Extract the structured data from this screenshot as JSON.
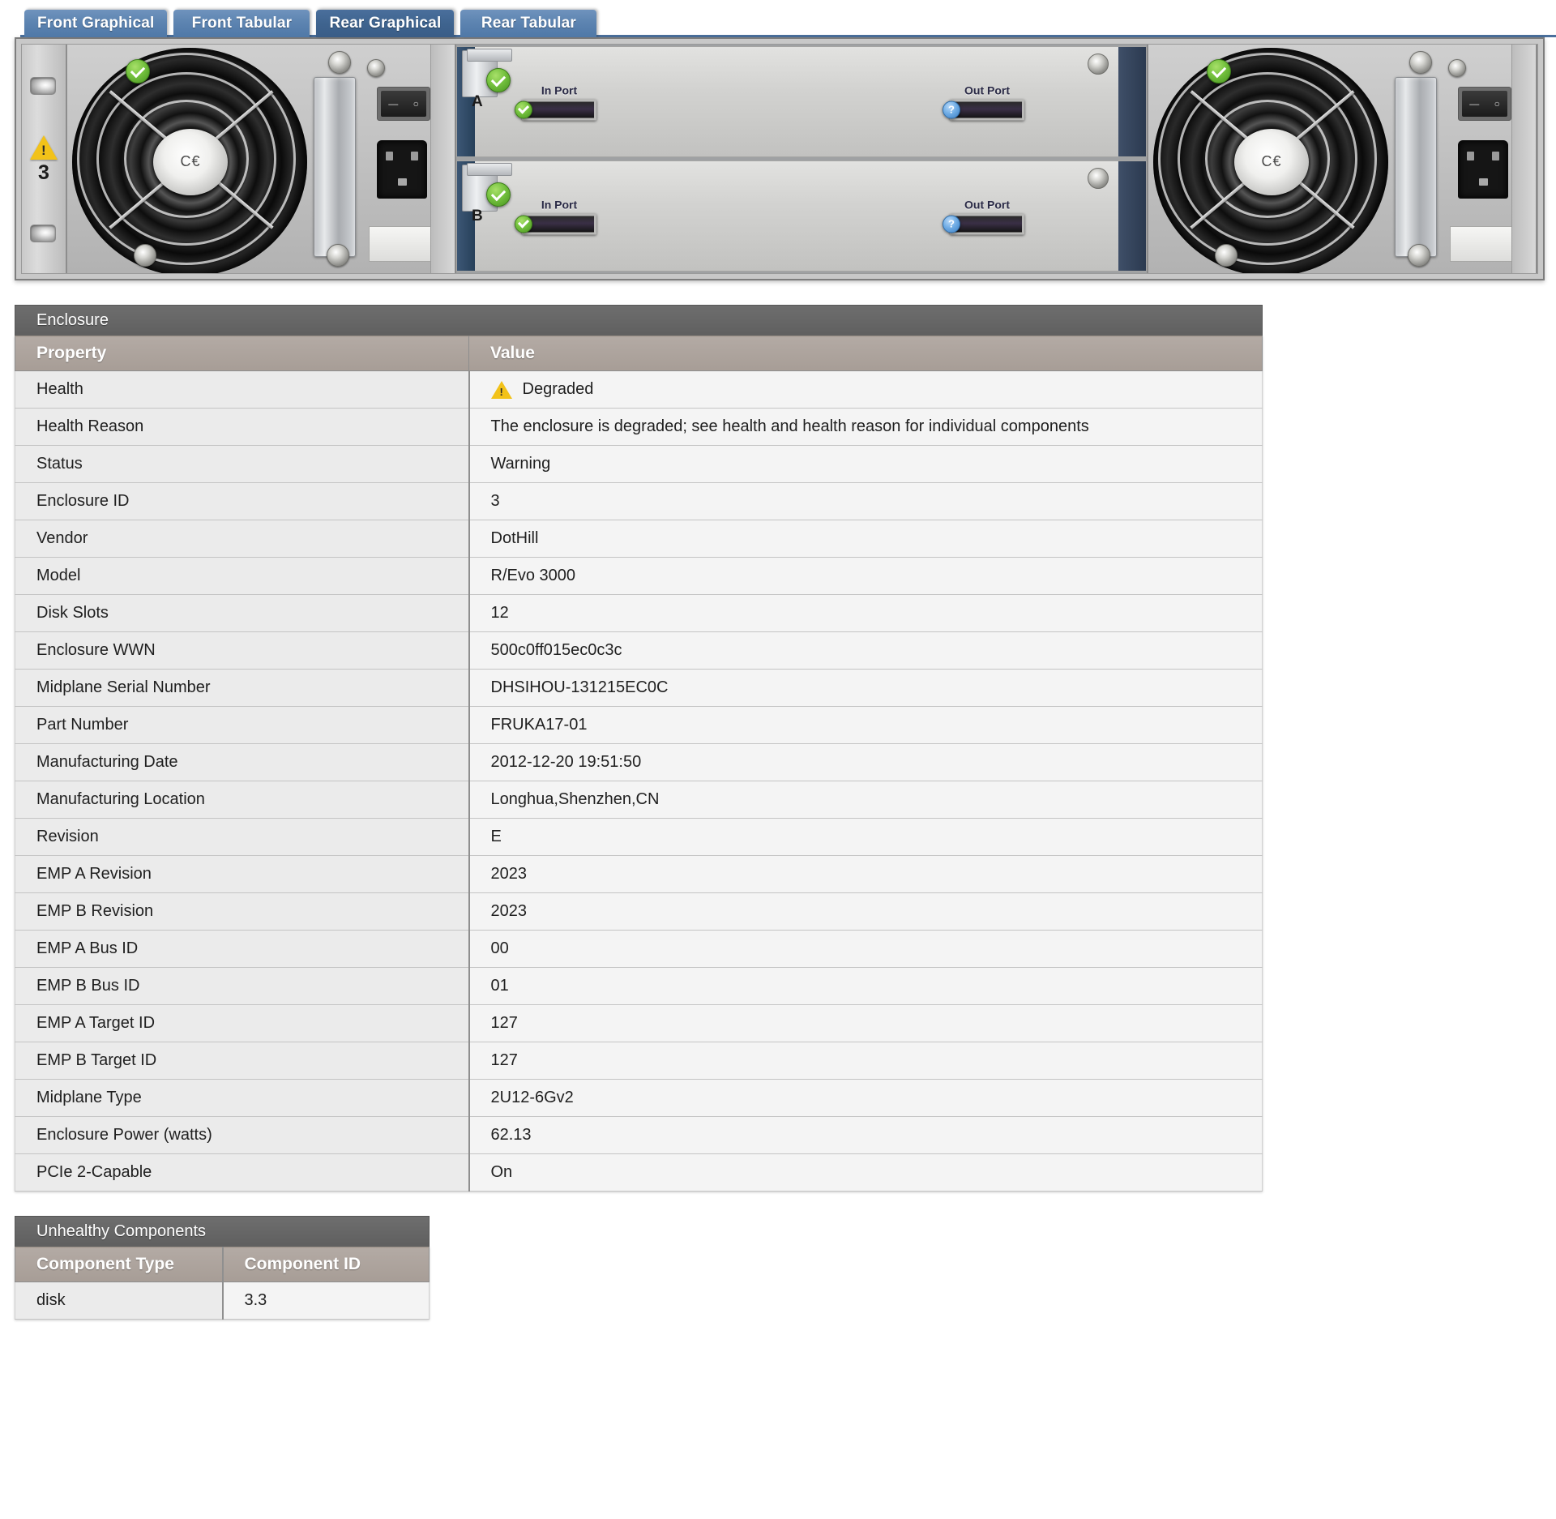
{
  "tabs": [
    {
      "label": "Front Graphical",
      "active": false
    },
    {
      "label": "Front Tabular",
      "active": false
    },
    {
      "label": "Rear Graphical",
      "active": true
    },
    {
      "label": "Rear Tabular",
      "active": false
    }
  ],
  "enclosure_graphic": {
    "view": "rear",
    "enclosure_id_label": "3",
    "health_icon": "warning-triangle-icon",
    "left_psu": {
      "name": "power-supply-left",
      "status_icon": "ok-check-icon"
    },
    "right_psu": {
      "name": "power-supply-right",
      "status_icon": "ok-check-icon"
    },
    "iom_modules": [
      {
        "letter": "A",
        "status_icon": "ok-check-icon",
        "ports": [
          {
            "label": "In Port",
            "status_icon": "ok-check-icon"
          },
          {
            "label": "Out Port",
            "status_icon": "unknown-question-icon"
          }
        ]
      },
      {
        "letter": "B",
        "status_icon": "ok-check-icon",
        "ports": [
          {
            "label": "In Port",
            "status_icon": "ok-check-icon"
          },
          {
            "label": "Out Port",
            "status_icon": "unknown-question-icon"
          }
        ]
      }
    ]
  },
  "enclosure_table": {
    "caption": "Enclosure",
    "headers": {
      "property": "Property",
      "value": "Value"
    },
    "rows": [
      {
        "property": "Health",
        "value": "Degraded",
        "icon": "warning-triangle-icon"
      },
      {
        "property": "Health Reason",
        "value": "The enclosure is degraded; see health and health reason for individual components"
      },
      {
        "property": "Status",
        "value": "Warning"
      },
      {
        "property": "Enclosure ID",
        "value": "3"
      },
      {
        "property": "Vendor",
        "value": "DotHill"
      },
      {
        "property": "Model",
        "value": "R/Evo 3000"
      },
      {
        "property": "Disk Slots",
        "value": "12"
      },
      {
        "property": "Enclosure WWN",
        "value": "500c0ff015ec0c3c"
      },
      {
        "property": "Midplane Serial Number",
        "value": "DHSIHOU-131215EC0C"
      },
      {
        "property": "Part Number",
        "value": "FRUKA17-01"
      },
      {
        "property": "Manufacturing Date",
        "value": "2012-12-20 19:51:50"
      },
      {
        "property": "Manufacturing Location",
        "value": "Longhua,Shenzhen,CN"
      },
      {
        "property": "Revision",
        "value": "E"
      },
      {
        "property": "EMP A Revision",
        "value": "2023"
      },
      {
        "property": "EMP B Revision",
        "value": "2023"
      },
      {
        "property": "EMP A Bus ID",
        "value": "00"
      },
      {
        "property": "EMP B Bus ID",
        "value": "01"
      },
      {
        "property": "EMP A Target ID",
        "value": "127"
      },
      {
        "property": "EMP B Target ID",
        "value": "127"
      },
      {
        "property": "Midplane Type",
        "value": "2U12-6Gv2"
      },
      {
        "property": "Enclosure Power (watts)",
        "value": "62.13"
      },
      {
        "property": "PCIe 2-Capable",
        "value": "On"
      }
    ]
  },
  "unhealthy_table": {
    "caption": "Unhealthy Components",
    "headers": {
      "type": "Component Type",
      "id": "Component ID"
    },
    "rows": [
      {
        "type": "disk",
        "id": "3.3"
      }
    ]
  },
  "colors": {
    "tab_active": "#3f648f",
    "tab_inactive": "#5d84b1",
    "caption_bar": "#6e6e6e",
    "header_bar": "#a79d96",
    "warning": "#f2c219",
    "ok": "#74c13e",
    "unknown": "#72aee6"
  }
}
